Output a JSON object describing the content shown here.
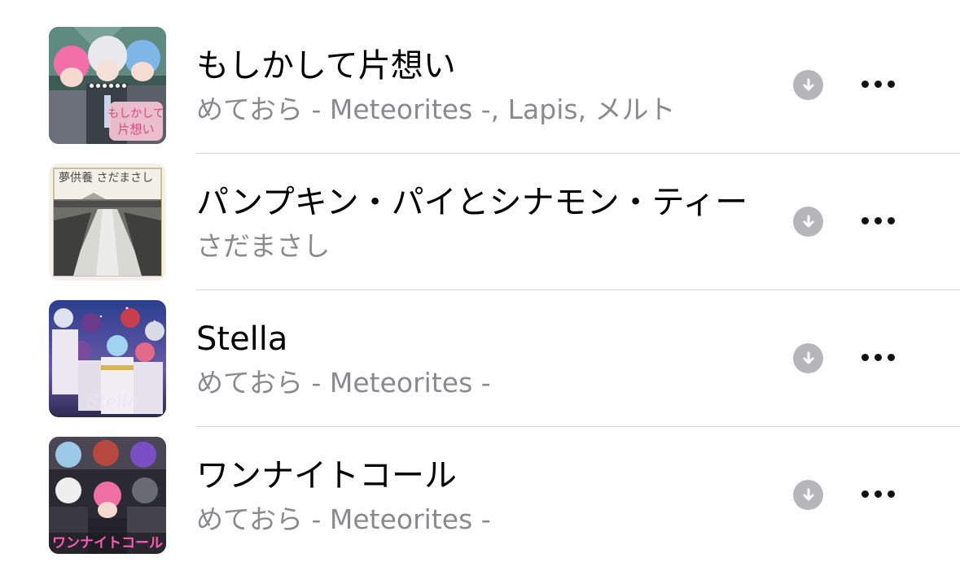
{
  "songs": [
    {
      "title": "もしかして片想い",
      "artist": "めておら - Meteorites -, Lapis, メルト",
      "is_playing": true,
      "artwork_icon": "album-artwork-anime-group",
      "artwork_text": "もしかして片想い"
    },
    {
      "title": "パンプキン・パイとシナモン・ティー",
      "artist": "さだまさし",
      "is_playing": false,
      "artwork_icon": "album-artwork-rural-road",
      "artwork_text": "夢供養 さだまさし"
    },
    {
      "title": "Stella",
      "artist": "めておら - Meteorites -",
      "is_playing": false,
      "artwork_icon": "album-artwork-anime-starry",
      "artwork_text": "Stella"
    },
    {
      "title": "ワンナイトコール",
      "artist": "めておら - Meteorites -",
      "is_playing": false,
      "artwork_icon": "album-artwork-anime-group",
      "artwork_text": "ワンナイトコール"
    }
  ],
  "icons": {
    "download": "download-arrow-circle-icon",
    "more": "ellipsis-more-icon"
  },
  "colors": {
    "title": "#000000",
    "subtitle": "#8a8a8e",
    "download_bg": "#b6b6b9",
    "divider": "#d6d6d8"
  }
}
